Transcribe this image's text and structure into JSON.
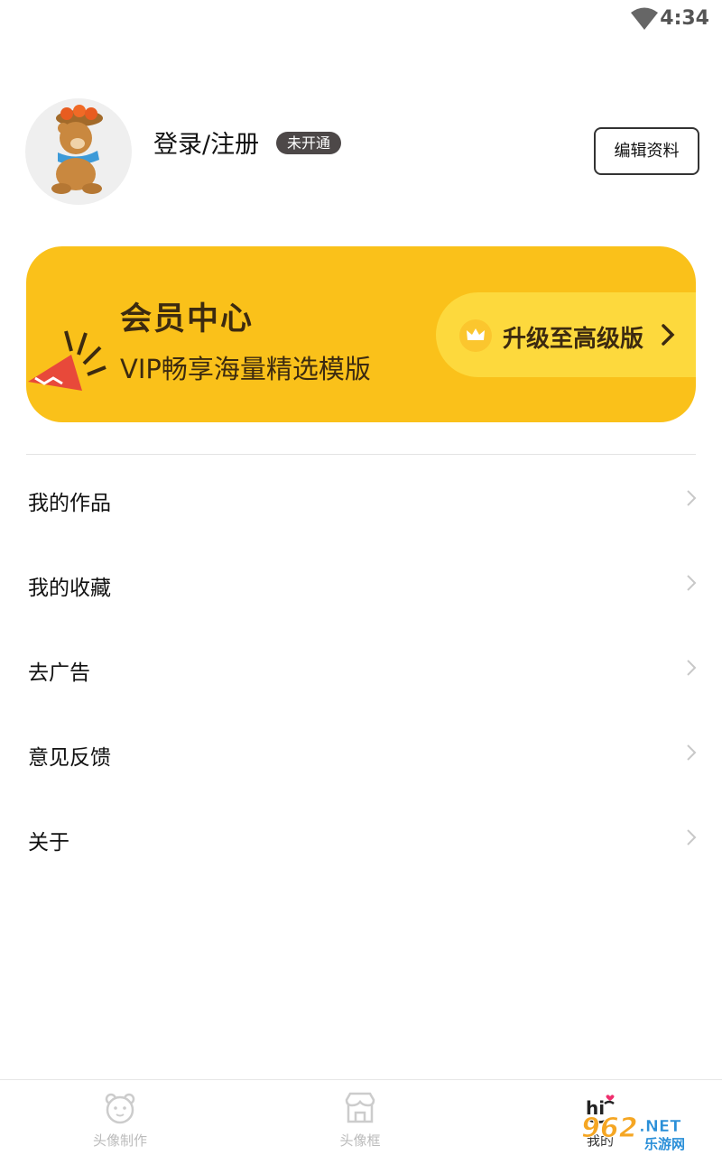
{
  "status_bar": {
    "time": "4:34",
    "icons": [
      "wifi-icon"
    ]
  },
  "profile": {
    "login_label": "登录/注册",
    "status_badge": "未开通",
    "edit_button": "编辑资料"
  },
  "vip": {
    "title": "会员中心",
    "subtitle": "VIP畅享海量精选模版",
    "upgrade_label": "升级至高级版",
    "colors": {
      "banner": "#fac11a",
      "pill": "#fdd93d",
      "text": "#3c2a10"
    }
  },
  "menu": [
    {
      "label": "我的作品"
    },
    {
      "label": "我的收藏"
    },
    {
      "label": "去广告"
    },
    {
      "label": "意见反馈"
    },
    {
      "label": "关于"
    }
  ],
  "tabs": [
    {
      "label": "头像制作",
      "icon": "bear-face-icon",
      "active": false
    },
    {
      "label": "头像框",
      "icon": "shop-frame-icon",
      "active": false
    },
    {
      "label": "我的",
      "icon": "hi-icon",
      "active": true
    }
  ],
  "watermark": {
    "text": "962",
    "suffix": ".NET",
    "sub": "乐游网"
  }
}
